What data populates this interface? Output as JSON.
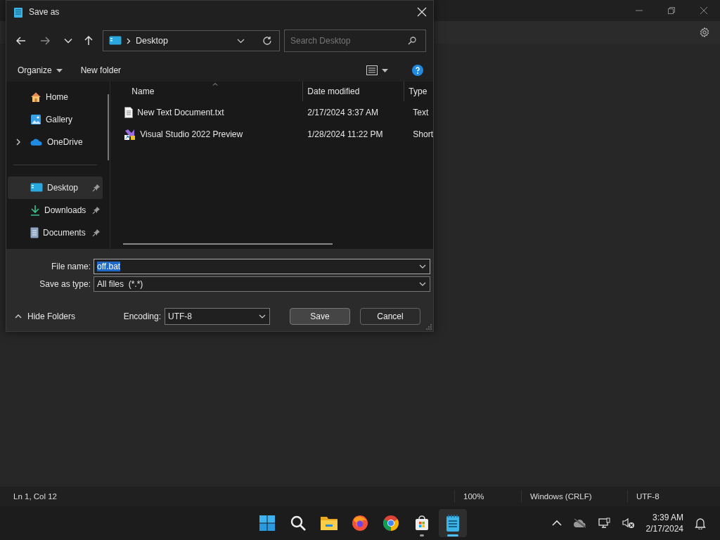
{
  "notepad": {
    "status_bar": [
      "Ln 1, Col 12",
      "100%",
      "Windows (CRLF)",
      "UTF-8"
    ]
  },
  "dialog": {
    "title": "Save as",
    "address": "Desktop",
    "search": {
      "placeholder": "Search Desktop"
    },
    "commands": [
      "Organize",
      "New folder"
    ],
    "nav_groups": [
      [
        {
          "label": "Home",
          "kind": "home",
          "expandable": false,
          "pinned": false,
          "selected": false
        },
        {
          "label": "Gallery",
          "kind": "gallery",
          "expandable": false,
          "pinned": false,
          "selected": false
        },
        {
          "label": "OneDrive",
          "kind": "cloud",
          "expandable": true,
          "pinned": false,
          "selected": false
        }
      ],
      [
        {
          "label": "Desktop",
          "kind": "desktop",
          "expandable": false,
          "pinned": true,
          "selected": true
        },
        {
          "label": "Downloads",
          "kind": "download",
          "expandable": false,
          "pinned": true,
          "selected": false
        },
        {
          "label": "Documents",
          "kind": "document",
          "expandable": false,
          "pinned": true,
          "selected": false
        }
      ]
    ],
    "columns": [
      "Name",
      "Date modified",
      "Type"
    ],
    "rows": [
      {
        "kind": "text",
        "name": "New Text Document.txt",
        "date": "2/17/2024 3:37 AM",
        "type": "Text"
      },
      {
        "kind": "shortcut",
        "name": "Visual Studio 2022 Preview",
        "date": "1/28/2024 11:22 PM",
        "type": "Short"
      }
    ],
    "file_name": {
      "label": "File name:",
      "value": "off.bat",
      "value_selected": true
    },
    "save_type": {
      "label": "Save as type:",
      "value": "All files  (*.*)"
    },
    "hide_folders": "Hide Folders",
    "encoding": {
      "label": "Encoding:",
      "value": "UTF-8"
    },
    "buttons": [
      {
        "label": "Save",
        "default": true
      },
      {
        "label": "Cancel",
        "default": false
      }
    ]
  },
  "taskbar": {
    "apps": [
      {
        "kind": "start",
        "running": false,
        "selected": false
      },
      {
        "kind": "search",
        "running": false,
        "selected": false
      },
      {
        "kind": "folder",
        "running": false,
        "selected": false
      },
      {
        "kind": "firefox",
        "running": false,
        "selected": false
      },
      {
        "kind": "chrome",
        "running": false,
        "selected": false
      },
      {
        "kind": "store",
        "running": true,
        "selected": false
      },
      {
        "kind": "notepad",
        "running": true,
        "selected": true
      }
    ],
    "time": "3:39 AM",
    "date": "2/17/2024"
  }
}
